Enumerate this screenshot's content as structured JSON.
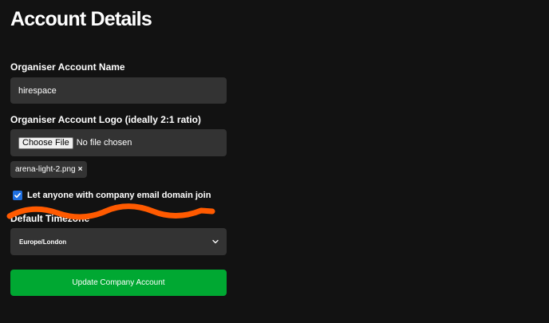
{
  "page": {
    "title": "Account Details"
  },
  "form": {
    "account_name": {
      "label": "Organiser Account Name",
      "value": "hirespace"
    },
    "logo": {
      "label": "Organiser Account Logo (ideally 2:1 ratio)",
      "choose_button": "Choose File",
      "status": "No file chosen",
      "uploaded_file": "arena-light-2.png",
      "remove_symbol": "×"
    },
    "domain_join": {
      "label": "Let anyone with company email domain join",
      "checked": true
    },
    "timezone": {
      "label": "Default Timezone",
      "value": "Europe/London"
    },
    "submit_label": "Update Company Account"
  },
  "colors": {
    "background": "#121212",
    "field": "#333333",
    "accent_green": "#00a832",
    "checkbox_blue": "#1f6fe0",
    "annotation_orange": "#ff5a00"
  }
}
